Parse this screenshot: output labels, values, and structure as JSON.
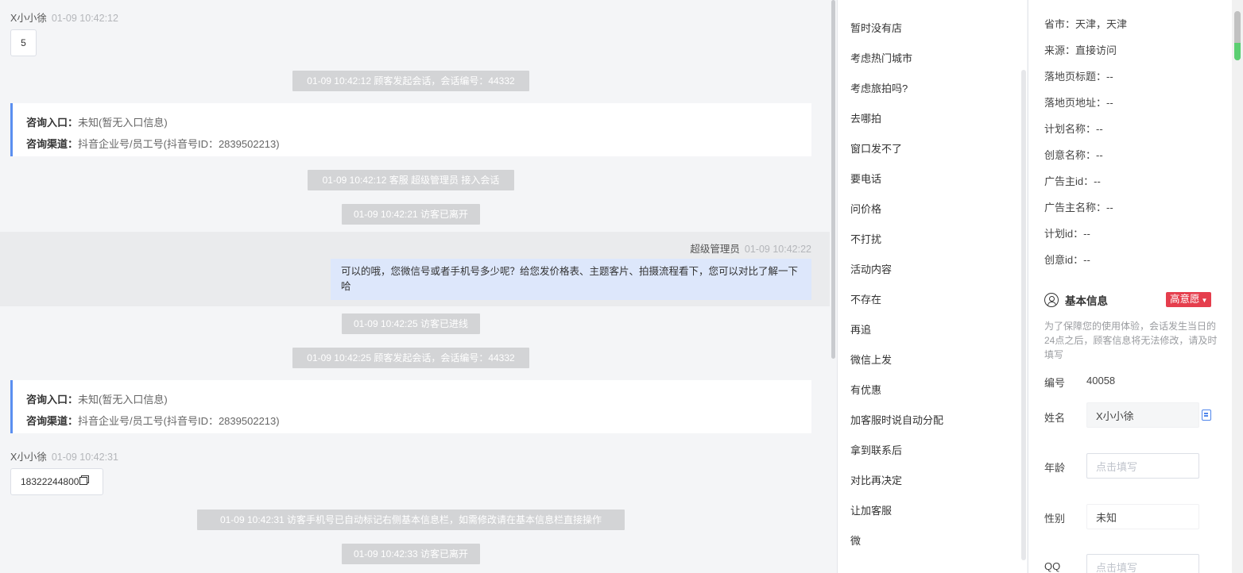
{
  "chat": {
    "msg1": {
      "sender": "X小小徐",
      "time": "01-09 10:42:12",
      "text": "5"
    },
    "sys1": "01-09 10:42:12 顾客发起会话，会话编号：44332",
    "entry1": {
      "entry_label": "咨询入口：",
      "entry_value": "未知(暂无入口信息)",
      "channel_label": "咨询渠道：",
      "channel_value": "抖音企业号/员工号(抖音号ID：2839502213)"
    },
    "sys2": "01-09 10:42:12 客服 超级管理员 接入会话",
    "sys3": "01-09 10:42:21 访客已离开",
    "agent_msg": {
      "sender": "超级管理员",
      "time": "01-09 10:42:22",
      "text": "可以的哦，您微信号或者手机号多少呢？给您发价格表、主题客片、拍摄流程看下，您可以对比了解一下哈"
    },
    "sys4": "01-09 10:42:25 访客已进线",
    "sys5": "01-09 10:42:25 顾客发起会话，会话编号：44332",
    "entry2": {
      "entry_label": "咨询入口：",
      "entry_value": "未知(暂无入口信息)",
      "channel_label": "咨询渠道：",
      "channel_value": "抖音企业号/员工号(抖音号ID：2839502213)"
    },
    "msg2": {
      "sender": "X小小徐",
      "time": "01-09 10:42:31",
      "text": "18322244800"
    },
    "sys6": "01-09 10:42:31 访客手机号已自动标记右侧基本信息栏，如需修改请在基本信息栏直接操作",
    "sys7": "01-09 10:42:33 访客已离开"
  },
  "quick_replies": [
    "暂时没有店",
    "考虑热门城市",
    "考虑旅拍吗?",
    "去哪拍",
    "窗口发不了",
    "要电话",
    "问价格",
    "不打扰",
    "活动内容",
    "不存在",
    "再追",
    "微信上发",
    "有优惠",
    "加客服时说自动分配",
    "拿到联系后",
    "对比再决定",
    "让加客服",
    "微"
  ],
  "info": {
    "source_fields": [
      {
        "label": "省市：",
        "value": "天津，天津"
      },
      {
        "label": "来源：",
        "value": "直接访问"
      },
      {
        "label": "落地页标题：",
        "value": "--"
      },
      {
        "label": "落地页地址：",
        "value": "--"
      },
      {
        "label": "计划名称：",
        "value": "--"
      },
      {
        "label": "创意名称：",
        "value": "--"
      },
      {
        "label": "广告主id：",
        "value": "--"
      },
      {
        "label": "广告主名称：",
        "value": "--"
      },
      {
        "label": "计划id：",
        "value": "--"
      },
      {
        "label": "创意id：",
        "value": "--"
      }
    ],
    "basic_title": "基本信息",
    "intent_tag": "高意愿",
    "tip": "为了保障您的使用体验，会话发生当日的24点之后，顾客信息将无法修改，请及时填写",
    "id_label": "编号",
    "id_value": "40058",
    "name_label": "姓名",
    "name_value": "X小小徐",
    "age_label": "年龄",
    "age_placeholder": "点击填写",
    "gender_label": "性别",
    "gender_value": "未知",
    "qq_label": "QQ",
    "qq_placeholder": "点击填写"
  },
  "colors": {
    "accent": "#5b8ff0",
    "intent_tag": "#e53e4d",
    "agent_bubble": "#dde7fb",
    "system_pill": "#d3d4d6"
  }
}
